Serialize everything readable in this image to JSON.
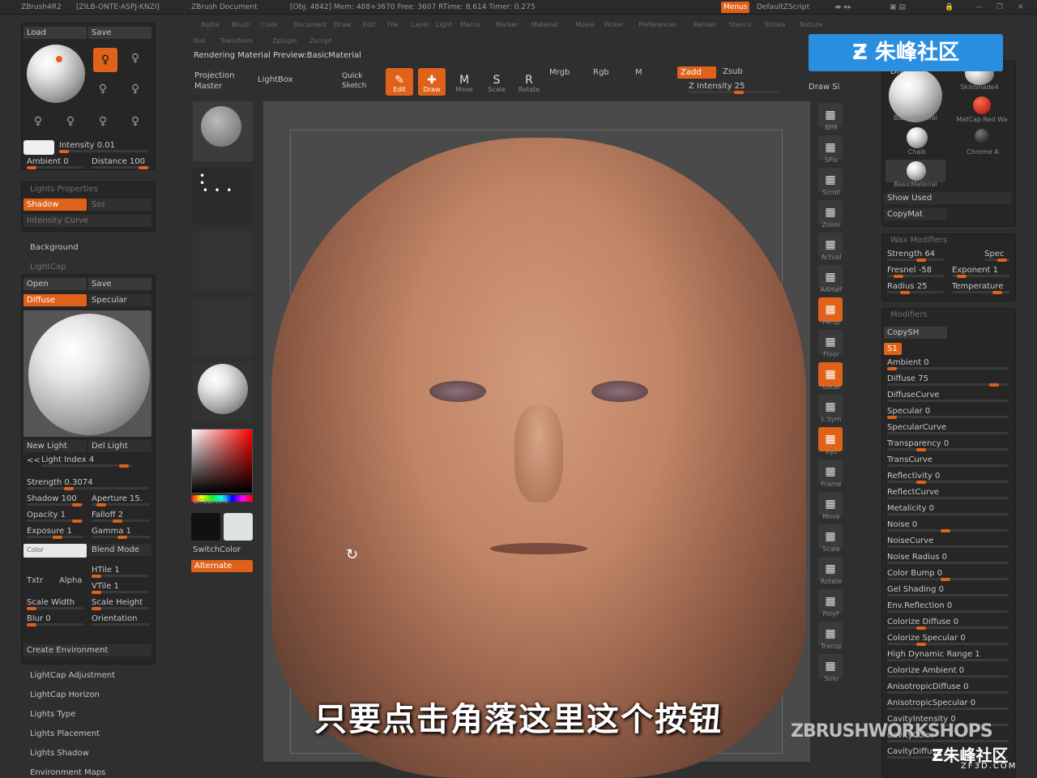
{
  "topbar": {
    "app": "ZBrush4R2",
    "license": "[ZILB-ONTE-ASPJ-KNZI]",
    "doc": "ZBrush Document",
    "stats": "[Obj: 4842] Mem: 488+3670 Free: 3607 RTime: 8.614 Timer: 0.275",
    "menus_btn": "Menus",
    "script": "DefaultZScript"
  },
  "menus": [
    "Alpha",
    "Brush",
    "Color",
    "Document",
    "Draw",
    "Edit",
    "File",
    "Layer",
    "Light",
    "Macro",
    "Marker",
    "Material",
    "Movie",
    "Picker",
    "Preferences",
    "Render",
    "Stencil",
    "Stroke",
    "Texture",
    "Tool",
    "Transform",
    "Zplugin",
    "Zscript"
  ],
  "title_bar": "Rendering Material Preview:BasicMaterial",
  "toolbar": {
    "projection_master": "Projection Master",
    "lightbox": "LightBox",
    "quick_sketch": "Quick Sketch",
    "edit": "Edit",
    "draw": "Draw",
    "move": "Move",
    "scale": "Scale",
    "rotate": "Rotate",
    "mrgb": "Mrgb",
    "rgb": "Rgb",
    "m": "M",
    "zadd": "Zadd",
    "zsub": "Zsub",
    "z_intensity": "Z Intensity 25",
    "draw_size": "Draw Si"
  },
  "light_panel": {
    "load": "Load",
    "save": "Save",
    "intensity": "Intensity 0.01",
    "ambient": "Ambient 0",
    "distance": "Distance 100",
    "lights_properties": "Lights Properties",
    "shadow": "Shadow",
    "sss": "Sss",
    "intensity_curve": "Intensity Curve",
    "background": "Background",
    "lightcap": "LightCap",
    "open": "Open",
    "save2": "Save",
    "diffuse": "Diffuse",
    "specular": "Specular",
    "new_light": "New Light",
    "del_light": "Del Light",
    "light_index": "Light Index 4",
    "strength": "Strength 0.3074",
    "shadow_val": "Shadow 100",
    "aperture": "Aperture 15.",
    "opacity": "Opacity 1",
    "falloff": "Falloff 2",
    "exposure": "Exposure 1",
    "gamma": "Gamma 1",
    "color": "Color",
    "blend_mode": "Blend Mode",
    "txtr": "Txtr",
    "alpha": "Alpha",
    "htile": "HTile 1",
    "vtile": "VTile 1",
    "scale_width": "Scale Width",
    "scale_height": "Scale Height",
    "blur": "Blur 0",
    "orientation": "Orientation",
    "create_environment": "Create Environment",
    "sections": [
      "LightCap Adjustment",
      "LightCap Horizon",
      "Lights Type",
      "Lights Placement",
      "Lights Shadow",
      "Environment Maps"
    ]
  },
  "left_shelf": {
    "gradient": "Gradient",
    "switchcolor": "SwitchColor",
    "alternate": "Alternate"
  },
  "right_shelf": [
    "BPR",
    "SPix",
    "Scroll",
    "Zoom",
    "Actual",
    "AAHalf",
    "Persp",
    "Floor",
    "Local",
    "L.Sym",
    "Xyz",
    "Frame",
    "Move",
    "Scale",
    "Rotate",
    "PolyF",
    "Transp",
    "Solo"
  ],
  "material_panel": {
    "top_label": "Draw Si",
    "skin_shade": "SkinShade4",
    "basic_material": "BasicMaterial",
    "matcap_red": "MatCap Red Wa",
    "chalk": "Chalk",
    "chrome": "Chrome A",
    "basic_material2": "BasicMaterial",
    "show_used": "Show Used",
    "copymat": "CopyMat",
    "wax_modifiers": "Wax Modifiers",
    "strength": "Strength 64",
    "spec": "Spec",
    "fresnel": "Fresnel -58",
    "exponent": "Exponent 1",
    "radius": "Radius 25",
    "temperature": "Temperature",
    "modifiers": "Modifiers",
    "copysh": "CopySH",
    "s1": "S1",
    "list": [
      "Ambient 0",
      "Diffuse 75",
      "DiffuseCurve",
      "Specular 0",
      "SpecularCurve",
      "Transparency 0",
      "TransCurve",
      "Reflectivity 0",
      "ReflectCurve",
      "Metalicity 0",
      "Noise 0",
      "NoiseCurve",
      "Noise Radius 0",
      "Color Bump 0",
      "Gel Shading 0",
      "Env.Reflection 0",
      "Colorize Diffuse 0",
      "Colorize Specular 0",
      "High Dynamic Range 1",
      "Colorize Ambient 0",
      "AnisotropicDiffuse 0",
      "AnisotropicSpecular 0",
      "CavityIntensity 0",
      "CavityColor",
      "CavityDiffuse"
    ]
  },
  "overlay": {
    "logo_text": "朱峰社区",
    "subtitle": "只要点击角落这里这个按钮",
    "watermark": "ZBRUSHWORKSHOPS",
    "corner_logo": "朱峰社区",
    "corner_url": "ZF3D.COM"
  },
  "colors": {
    "accent": "#e0621a",
    "panel": "#262626",
    "button": "#3a3a3a",
    "logo_blue": "#2b8fe0"
  }
}
